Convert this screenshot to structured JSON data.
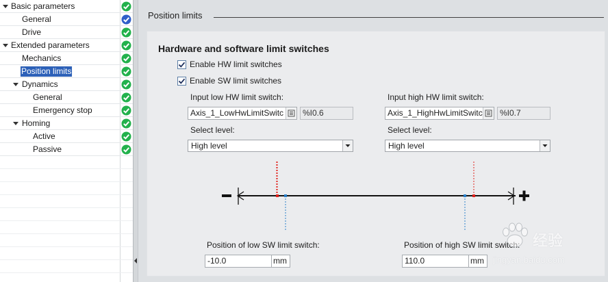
{
  "tree": {
    "items": [
      {
        "label": "Basic parameters",
        "status": "ok"
      },
      {
        "label": "General",
        "status": "done"
      },
      {
        "label": "Drive",
        "status": "ok"
      },
      {
        "label": "Extended parameters",
        "status": "ok"
      },
      {
        "label": "Mechanics",
        "status": "ok"
      },
      {
        "label": "Position limits",
        "status": "ok",
        "selected": true
      },
      {
        "label": "Dynamics",
        "status": "ok"
      },
      {
        "label": "General",
        "status": "ok"
      },
      {
        "label": "Emergency stop",
        "status": "ok"
      },
      {
        "label": "Homing",
        "status": "ok"
      },
      {
        "label": "Active",
        "status": "ok"
      },
      {
        "label": "Passive",
        "status": "ok"
      }
    ]
  },
  "section": {
    "title": "Position limits"
  },
  "group": {
    "title": "Hardware and software limit switches",
    "enable_hw": {
      "label": "Enable HW limit switches",
      "checked": true
    },
    "enable_sw": {
      "label": "Enable SW limit switches",
      "checked": true
    },
    "low_hw": {
      "label": "Input low HW limit switch:",
      "tag": "Axis_1_LowHwLimitSwitc",
      "address": "%I0.6",
      "level_label": "Select level:",
      "level": "High level"
    },
    "high_hw": {
      "label": "Input high HW limit switch:",
      "tag": "Axis_1_HighHwLimitSwitc",
      "address": "%I0.7",
      "level_label": "Select level:",
      "level": "High level"
    },
    "low_sw": {
      "label": "Position of low SW limit switch:",
      "value": "-10.0",
      "unit": "mm"
    },
    "high_sw": {
      "label": "Position of high SW limit switch:",
      "value": "110.0",
      "unit": "mm"
    }
  },
  "watermark": {
    "text": "经验",
    "url": "jingyan.baidu.com"
  },
  "colors": {
    "ok": "#22b14c",
    "done": "#2f5fc9",
    "selection": "#2d61b8",
    "hw_marker": "#e0201b",
    "sw_marker": "#2a7fc9"
  },
  "icons": {
    "ok": "green-check-circle-icon",
    "done": "blue-check-circle-icon",
    "expand": "expand-arrow-icon",
    "browse": "list-browse-icon",
    "dropdown": "chevron-down-icon",
    "minus": "minus-icon",
    "plus": "plus-icon"
  }
}
